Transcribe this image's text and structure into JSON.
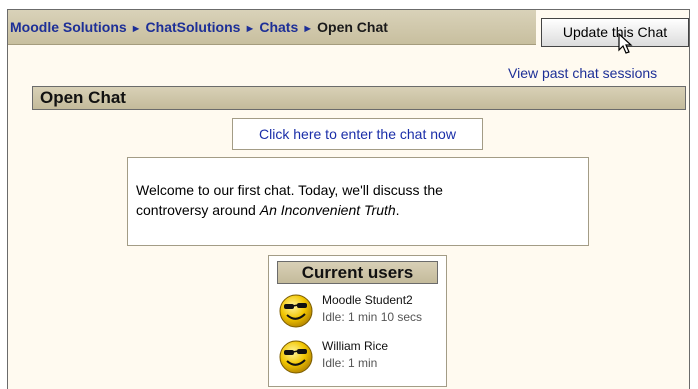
{
  "navbar": {
    "breadcrumbs": [
      "Moodle Solutions",
      "ChatSolutions",
      "Chats"
    ],
    "separator": "►",
    "current": "Open Chat",
    "update_button": "Update this Chat"
  },
  "links": {
    "past_sessions": "View past chat sessions"
  },
  "page": {
    "heading": "Open Chat",
    "enter_link": "Click here to enter the chat now",
    "intro_line1": "Welcome to our first chat. Today, we'll discuss the",
    "intro_line2_prefix": "controversy around ",
    "intro_line2_title": "An Inconvenient Truth",
    "intro_line2_suffix": "."
  },
  "users_block": {
    "title": "Current users",
    "users": [
      {
        "name": "Moodle Student2",
        "idle": "Idle: 1 min 10 secs",
        "avatar": "smiley-face-icon"
      },
      {
        "name": "William Rice",
        "idle": "Idle: 1 min",
        "avatar": "smiley-face-icon"
      }
    ]
  },
  "colors": {
    "link": "#1d2f97",
    "bar": "#c8bf9f",
    "panel": "#fffaf0"
  }
}
